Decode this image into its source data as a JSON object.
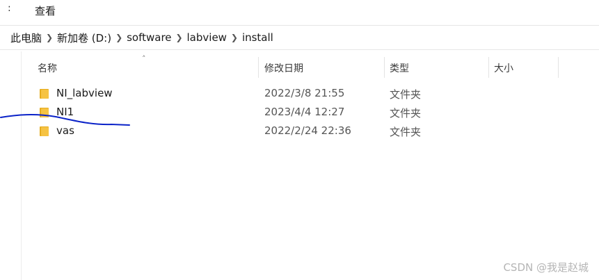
{
  "ribbon": {
    "fragment": ":",
    "view_label": "查看"
  },
  "address": {
    "crumbs": [
      "此电脑",
      "新加卷 (D:)",
      "software",
      "labview",
      "install"
    ]
  },
  "columns": {
    "name": "名称",
    "modified": "修改日期",
    "type": "类型",
    "size": "大小"
  },
  "files": [
    {
      "name": "NI_labview",
      "modified": "2022/3/8 21:55",
      "type": "文件夹"
    },
    {
      "name": "NI1",
      "modified": "2023/4/4 12:27",
      "type": "文件夹"
    },
    {
      "name": "vas",
      "modified": "2022/2/24 22:36",
      "type": "文件夹"
    }
  ],
  "colors": {
    "folder": "#f6c343",
    "folder_dark": "#e6ac1e",
    "annotation_ink": "#0a22c8"
  },
  "watermark": "CSDN @我是赵城"
}
